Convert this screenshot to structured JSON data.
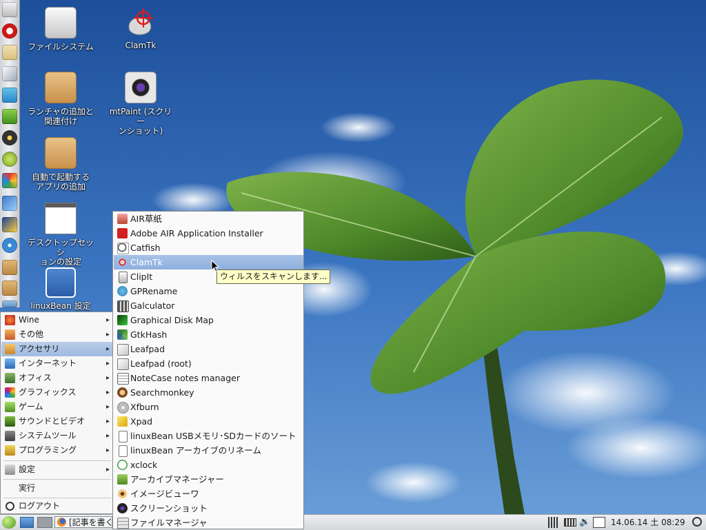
{
  "desktop": {
    "icons": [
      {
        "label": "ファイルシステム"
      },
      {
        "label": "ClamTk"
      },
      {
        "label": "ランチャの追加と\n関連付け"
      },
      {
        "label": "mtPaint (スクリー\nンショット)"
      },
      {
        "label": "自動で起動する\nアプリの追加"
      },
      {
        "label": "デスクトップセッシ\nョンの設定"
      },
      {
        "label": "linuxBean 設定"
      }
    ]
  },
  "main_menu": {
    "items": [
      {
        "label": "Wine",
        "icon": "wine-icon"
      },
      {
        "label": "その他",
        "icon": "other-icon"
      },
      {
        "label": "アクセサリ",
        "icon": "accessories-icon"
      },
      {
        "label": "インターネット",
        "icon": "internet-icon"
      },
      {
        "label": "オフィス",
        "icon": "office-icon"
      },
      {
        "label": "グラフィックス",
        "icon": "graphics-icon"
      },
      {
        "label": "ゲーム",
        "icon": "games-icon"
      },
      {
        "label": "サウンドとビデオ",
        "icon": "sound-video-icon"
      },
      {
        "label": "システムツール",
        "icon": "system-tools-icon"
      },
      {
        "label": "プログラミング",
        "icon": "programming-icon"
      }
    ],
    "settings": "設定",
    "run": "実行",
    "logout": "ログアウト"
  },
  "submenu": {
    "items": [
      "AIR草紙",
      "Adobe AIR Application Installer",
      "Catfish",
      "ClamTk",
      "ClipIt",
      "GPRename",
      "Galculator",
      "Graphical Disk Map",
      "GtkHash",
      "Leafpad",
      "Leafpad (root)",
      "NoteCase notes manager",
      "Searchmonkey",
      "Xfburn",
      "Xpad",
      "linuxBean USBメモリ･SDカードのソート",
      "linuxBean アーカイブのリネーム",
      "xclock",
      "アーカイブマネージャー",
      "イメージビューワ",
      "スクリーンショット",
      "ファイルマネージャ"
    ],
    "selected_index": 3
  },
  "tooltip": "ウィルスをスキャンします...",
  "taskbar": {
    "task_label": "[記事を書く",
    "clock": "14.06.14 土 08:29"
  }
}
